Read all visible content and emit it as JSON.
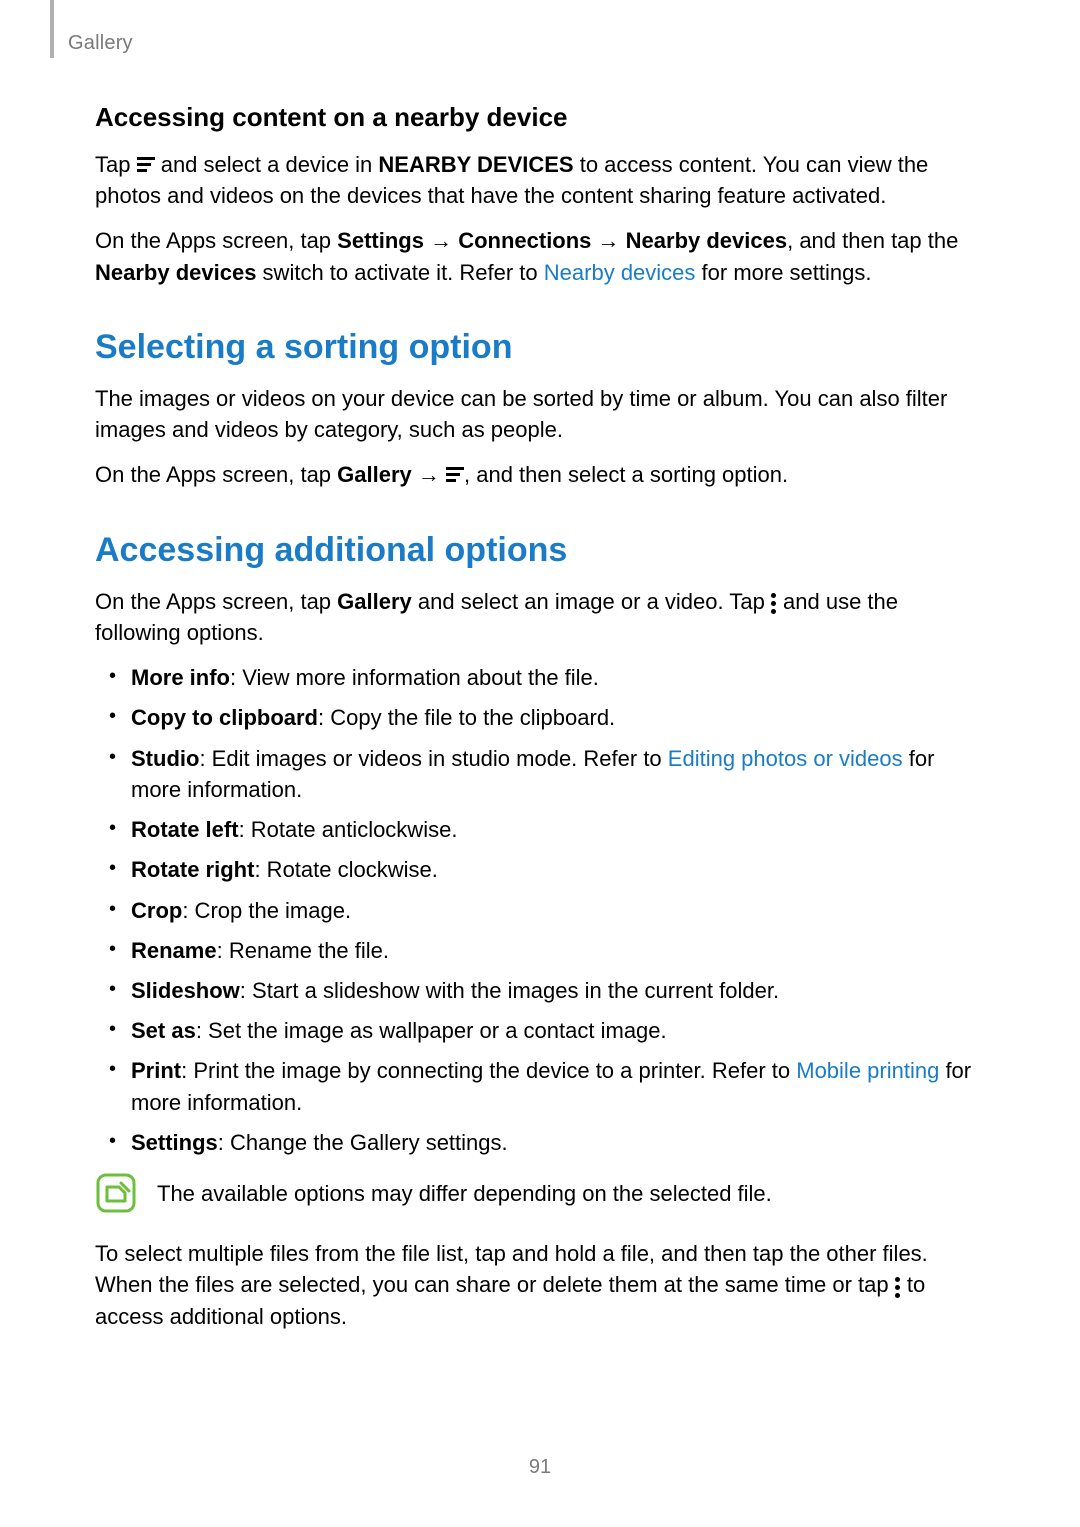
{
  "header": {
    "section": "Gallery"
  },
  "s1": {
    "heading": "Accessing content on a nearby device",
    "p1a": "Tap ",
    "p1b": " and select a device in ",
    "p1b_bold": "NEARBY DEVICES",
    "p1c": " to access content. You can view the photos and videos on the devices that have the content sharing feature activated.",
    "p2a": "On the Apps screen, tap ",
    "p2_b1": "Settings",
    "arrow": " → ",
    "p2_b2": "Connections",
    "p2_b3": "Nearby devices",
    "p2b": ", and then tap the ",
    "p2_b4": "Nearby devices",
    "p2c": " switch to activate it. Refer to ",
    "p2_link": "Nearby devices",
    "p2d": " for more settings."
  },
  "s2": {
    "heading": "Selecting a sorting option",
    "p1": "The images or videos on your device can be sorted by time or album. You can also filter images and videos by category, such as people.",
    "p2a": "On the Apps screen, tap ",
    "p2_b1": "Gallery",
    "p2b": ", and then select a sorting option."
  },
  "s3": {
    "heading": "Accessing additional options",
    "p1a": "On the Apps screen, tap ",
    "p1_b1": "Gallery",
    "p1b": " and select an image or a video. Tap ",
    "p1c": " and use the following options.",
    "items": [
      {
        "b": "More info",
        "t": ": View more information about the file."
      },
      {
        "b": "Copy to clipboard",
        "t": ": Copy the file to the clipboard."
      },
      {
        "b": "Studio",
        "t1": ": Edit images or videos in studio mode. Refer to ",
        "link": "Editing photos or videos",
        "t2": " for more information."
      },
      {
        "b": "Rotate left",
        "t": ": Rotate anticlockwise."
      },
      {
        "b": "Rotate right",
        "t": ": Rotate clockwise."
      },
      {
        "b": "Crop",
        "t": ": Crop the image."
      },
      {
        "b": "Rename",
        "t": ": Rename the file."
      },
      {
        "b": "Slideshow",
        "t": ": Start a slideshow with the images in the current folder."
      },
      {
        "b": "Set as",
        "t": ": Set the image as wallpaper or a contact image."
      },
      {
        "b": "Print",
        "t1": ": Print the image by connecting the device to a printer. Refer to ",
        "link": "Mobile printing",
        "t2": " for more information."
      },
      {
        "b": "Settings",
        "t": ": Change the Gallery settings."
      }
    ],
    "note": "The available options may differ depending on the selected file.",
    "p_last_a": "To select multiple files from the file list, tap and hold a file, and then tap the other files. When the files are selected, you can share or delete them at the same time or tap ",
    "p_last_b": " to access additional options."
  },
  "page_number": "91"
}
